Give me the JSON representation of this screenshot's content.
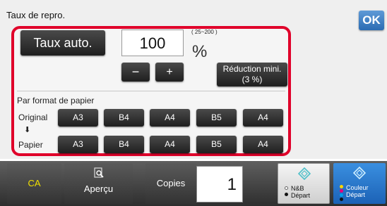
{
  "panel": {
    "title": "Taux de repro.",
    "ok_label": "OK"
  },
  "ratio": {
    "auto_label": "Taux auto.",
    "value": "100",
    "range": "( 25~200 )",
    "unit": "%",
    "minus_label": "−",
    "plus_label": "+",
    "reduction_line1": "Réduction mini.",
    "reduction_line2": "(3 %)"
  },
  "paper_format": {
    "section_label": "Par format de papier",
    "original_label": "Original",
    "arrow": "⬇",
    "paper_label": "Papier",
    "original_sizes": [
      "A3",
      "B4",
      "A4",
      "B5",
      "A4"
    ],
    "paper_sizes": [
      "A3",
      "B4",
      "A4",
      "B5",
      "A4"
    ]
  },
  "bottom_bar": {
    "ca_label": "CA",
    "preview_label": "Aperçu",
    "copies_label": "Copies",
    "copies_value": "1",
    "bw_line1": "N&B",
    "bw_line2": "Départ",
    "color_line1": "Couleur",
    "color_line2": "Départ"
  },
  "colors": {
    "accent_frame": "#e0002a",
    "ok_blue": "#2b6cb3",
    "ca_text": "#f0e000",
    "color_start_blue": "#1c62b6"
  },
  "icons": {
    "preview": "magnifier-document-icon",
    "start": "diamond-start-icon"
  }
}
